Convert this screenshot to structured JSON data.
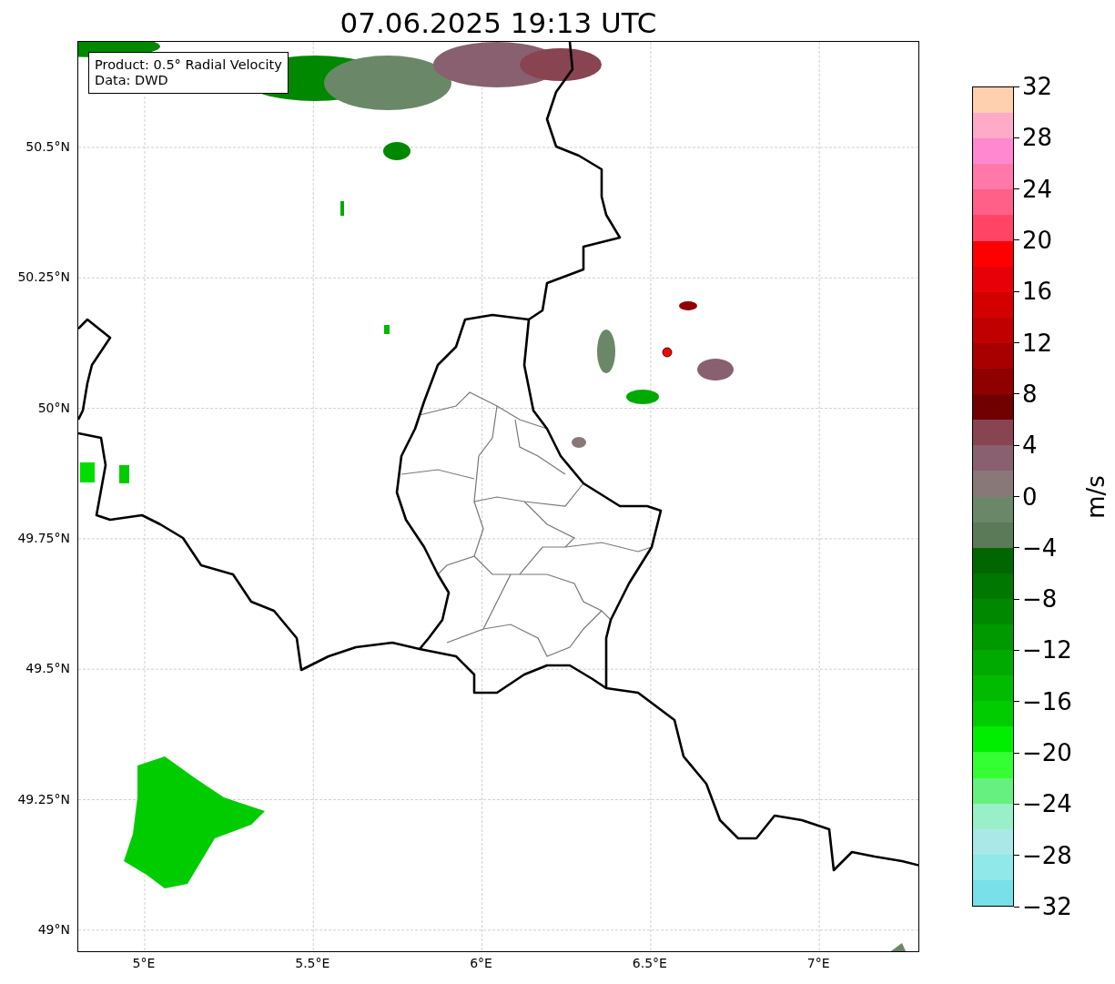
{
  "title": "07.06.2025 19:13 UTC",
  "info_box": {
    "lines": [
      "Product: 0.5° Radial Velocity",
      "Data: DWD"
    ]
  },
  "map": {
    "lat_labels": [
      "50.5°N",
      "50.25°N",
      "50°N",
      "49.75°N",
      "49.5°N",
      "49.25°N",
      "49°N"
    ],
    "lon_labels": [
      "5°E",
      "5.5°E",
      "6°E",
      "6.5°E",
      "7°E"
    ]
  },
  "colorbar": {
    "label": "m/s",
    "ticks": [
      "32",
      "28",
      "24",
      "20",
      "16",
      "12",
      "8",
      "4",
      "0",
      "−4",
      "−8",
      "−12",
      "−16",
      "−20",
      "−24",
      "−28",
      "−32"
    ],
    "bands": [
      {
        "color": "#ffd0b0"
      },
      {
        "color": "#ffaac8"
      },
      {
        "color": "#ff88d0"
      },
      {
        "color": "#ff78a8"
      },
      {
        "color": "#ff6088"
      },
      {
        "color": "#ff4466"
      },
      {
        "color": "#ff0000"
      },
      {
        "color": "#e80008"
      },
      {
        "color": "#d40000"
      },
      {
        "color": "#c00000"
      },
      {
        "color": "#a80000"
      },
      {
        "color": "#900000"
      },
      {
        "color": "#700000"
      },
      {
        "color": "#884450"
      },
      {
        "color": "#886070"
      },
      {
        "color": "#887878"
      },
      {
        "color": "#6a8868"
      },
      {
        "color": "#5a7a58"
      },
      {
        "color": "#006600"
      },
      {
        "color": "#007700"
      },
      {
        "color": "#008800"
      },
      {
        "color": "#009900"
      },
      {
        "color": "#00aa00"
      },
      {
        "color": "#00bb00"
      },
      {
        "color": "#00cc00"
      },
      {
        "color": "#00ee00"
      },
      {
        "color": "#33ff33"
      },
      {
        "color": "#66f080"
      },
      {
        "color": "#99f0c8"
      },
      {
        "color": "#aae8e8"
      },
      {
        "color": "#90e8e8"
      },
      {
        "color": "#77e0e8"
      }
    ]
  }
}
